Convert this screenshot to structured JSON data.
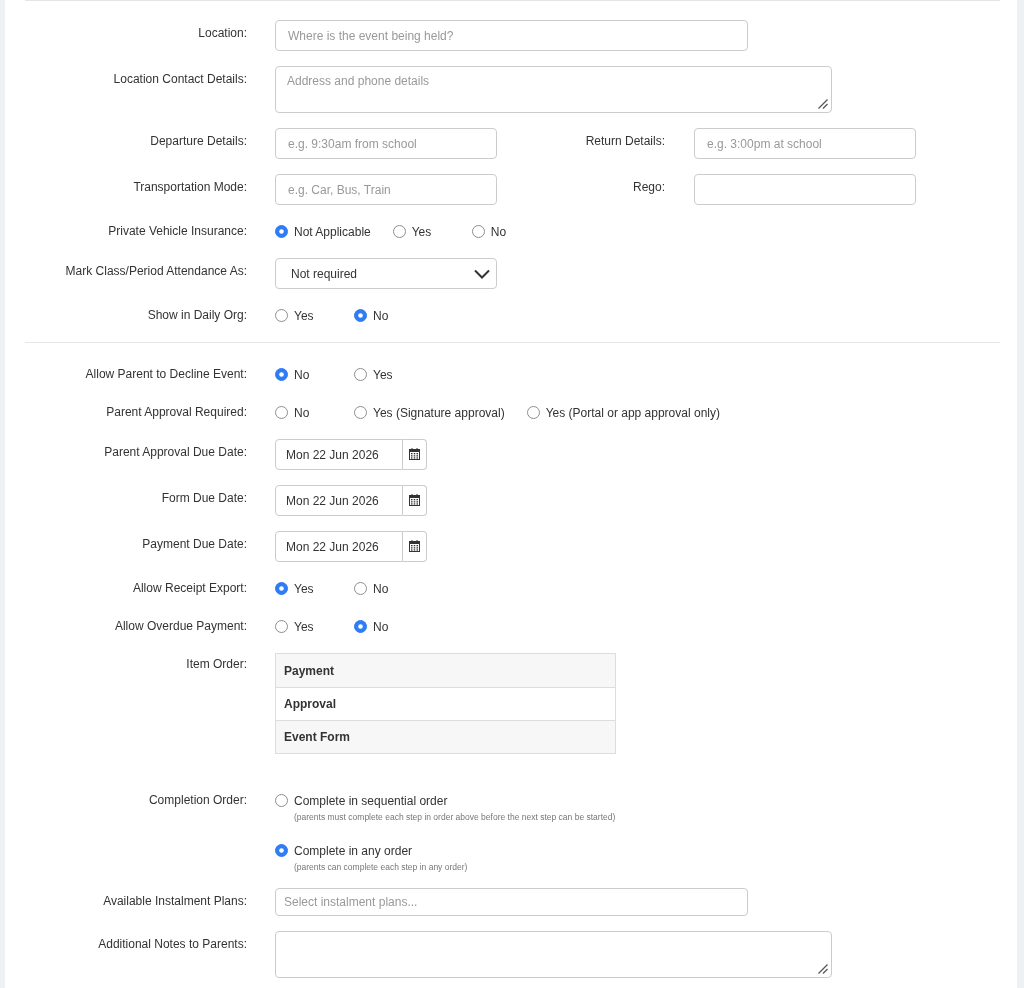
{
  "sections": [
    {
      "fields": [
        {
          "kind": "text",
          "label": "Location:",
          "placeholder": "Where is the event being held?"
        },
        {
          "kind": "textarea",
          "label": "Location Contact Details:",
          "placeholder": "Address and phone details"
        },
        {
          "kind": "pair",
          "fields": [
            {
              "label": "Departure Details:",
              "placeholder": "e.g. 9:30am from school"
            },
            {
              "label": "Return Details:",
              "placeholder": "e.g. 3:00pm at school"
            }
          ]
        },
        {
          "kind": "pair",
          "fields": [
            {
              "label": "Transportation Mode:",
              "placeholder": "e.g. Car, Bus, Train"
            },
            {
              "label": "Rego:"
            }
          ]
        },
        {
          "kind": "radio",
          "label": "Private Vehicle Insurance:",
          "options": [
            {
              "label": "Not Applicable",
              "selected": true
            },
            {
              "label": "Yes",
              "selected": false
            },
            {
              "label": "No",
              "selected": false
            }
          ]
        },
        {
          "kind": "select",
          "label": "Mark Class/Period Attendance As:",
          "value": "Not required"
        },
        {
          "kind": "radio",
          "label": "Show in Daily Org:",
          "options": [
            {
              "label": "Yes",
              "selected": false
            },
            {
              "label": "No",
              "selected": true
            }
          ]
        }
      ]
    },
    {
      "fields": [
        {
          "kind": "radio",
          "label": "Allow Parent to Decline Event:",
          "options": [
            {
              "label": "No",
              "selected": true
            },
            {
              "label": "Yes",
              "selected": false
            }
          ]
        },
        {
          "kind": "radio",
          "label": "Parent Approval Required:",
          "options": [
            {
              "label": "No",
              "selected": false
            },
            {
              "label": "Yes (Signature approval)",
              "selected": false
            },
            {
              "label": "Yes (Portal or app approval only)",
              "selected": false
            }
          ]
        },
        {
          "kind": "date",
          "label": "Parent Approval Due Date:",
          "value": "Mon 22 Jun 2026"
        },
        {
          "kind": "date",
          "label": "Form Due Date:",
          "value": "Mon 22 Jun 2026"
        },
        {
          "kind": "date",
          "label": "Payment Due Date:",
          "value": "Mon 22 Jun 2026"
        },
        {
          "kind": "radio",
          "label": "Allow Receipt Export:",
          "options": [
            {
              "label": "Yes",
              "selected": true
            },
            {
              "label": "No",
              "selected": false
            }
          ]
        },
        {
          "kind": "radio",
          "label": "Allow Overdue Payment:",
          "options": [
            {
              "label": "Yes",
              "selected": false
            },
            {
              "label": "No",
              "selected": true
            }
          ]
        },
        {
          "kind": "list",
          "label": "Item Order:",
          "items": [
            "Payment",
            "Approval",
            "Event Form"
          ]
        },
        {
          "kind": "radio_stacked",
          "label": "Completion Order:",
          "options": [
            {
              "label": "Complete in sequential order",
              "hint": "(parents must complete each step in order above before the next step can be started)",
              "selected": false
            },
            {
              "label": "Complete in any order",
              "hint": "(parents can complete each step in any order)",
              "selected": true
            }
          ]
        },
        {
          "kind": "multiselect",
          "label": "Available Instalment Plans:",
          "placeholder": "Select instalment plans..."
        },
        {
          "kind": "textarea",
          "label": "Additional Notes to Parents:"
        }
      ]
    }
  ]
}
